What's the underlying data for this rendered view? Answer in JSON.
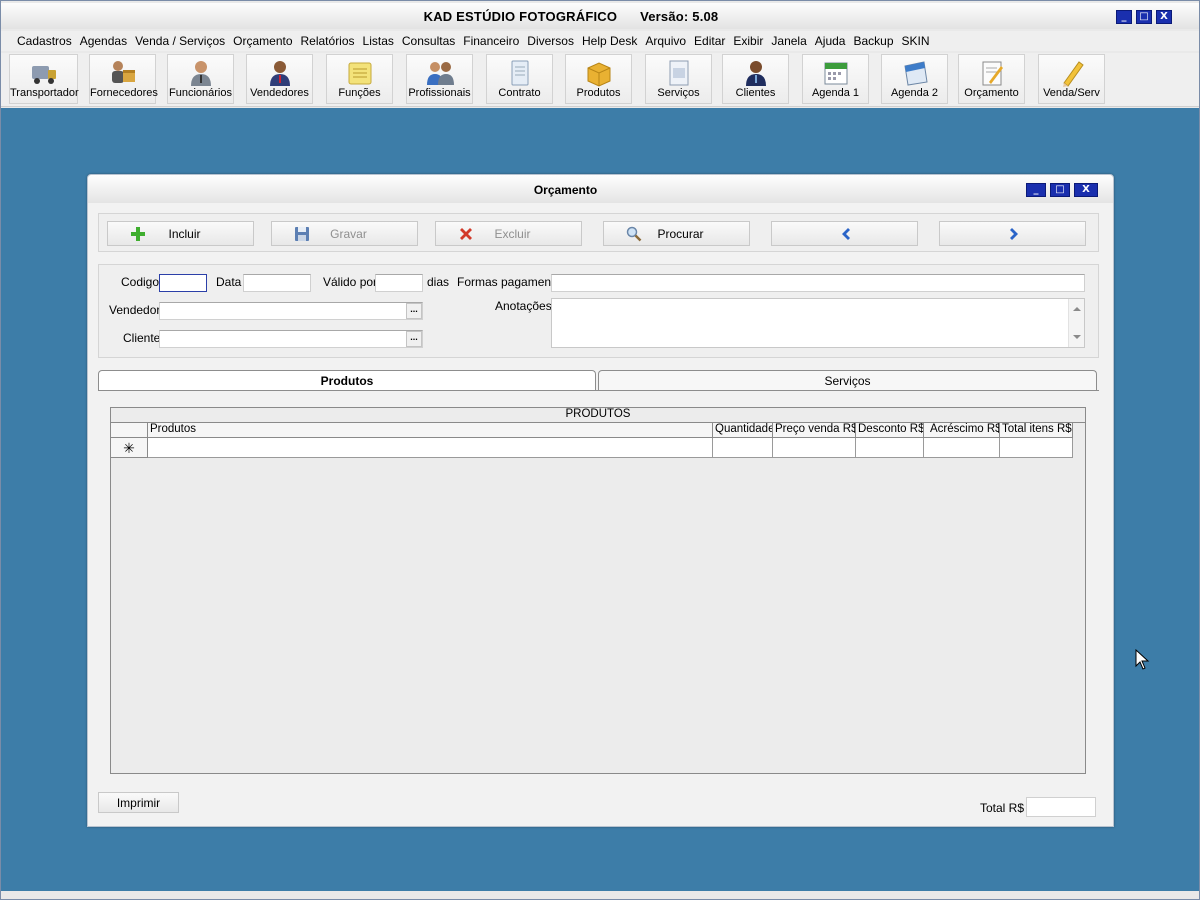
{
  "app": {
    "title": "KAD ESTÚDIO FOTOGRÁFICO",
    "version_label": "Versão: 5.08",
    "window_controls": [
      "_",
      "□",
      "X"
    ]
  },
  "menu": [
    "Cadastros",
    "Agendas",
    "Venda / Serviços",
    "Orçamento",
    "Relatórios",
    "Listas",
    "Consultas",
    "Financeiro",
    "Diversos",
    "Help Desk",
    "Arquivo",
    "Editar",
    "Exibir",
    "Janela",
    "Ajuda",
    "Backup",
    "SKIN"
  ],
  "toolbar": [
    {
      "label": "Transportador",
      "icon": "truck-icon"
    },
    {
      "label": "Fornecedores",
      "icon": "suppliers-icon"
    },
    {
      "label": "Funcionários",
      "icon": "employee-icon"
    },
    {
      "label": "Vendedores",
      "icon": "salesperson-icon"
    },
    {
      "label": "Funções",
      "icon": "notepad-icon"
    },
    {
      "label": "Profissionais",
      "icon": "professionals-icon"
    },
    {
      "label": "Contrato",
      "icon": "contract-icon"
    },
    {
      "label": "Produtos",
      "icon": "box-icon"
    },
    {
      "label": "Serviços",
      "icon": "services-doc-icon"
    },
    {
      "label": "Clientes",
      "icon": "client-icon"
    },
    {
      "label": "Agenda 1",
      "icon": "calendar-icon"
    },
    {
      "label": "Agenda 2",
      "icon": "calendar-2-icon"
    },
    {
      "label": "Orçamento",
      "icon": "quote-icon"
    },
    {
      "label": "Venda/Serv",
      "icon": "pencil-icon"
    }
  ],
  "dialog": {
    "title": "Orçamento",
    "actions": {
      "incluir": "Incluir",
      "gravar": "Gravar",
      "excluir": "Excluir",
      "procurar": "Procurar"
    },
    "form": {
      "codigo_label": "Codigo",
      "data_label": "Data",
      "valido_label": "Válido por",
      "dias_label": "dias",
      "formas_label": "Formas pagamento",
      "vendedor_label": "Vendedor",
      "anotacoes_label": "Anotações",
      "cliente_label": "Cliente",
      "lookup_label": "..."
    },
    "tabs": {
      "produtos": "Produtos",
      "servicos": "Serviços"
    },
    "grid": {
      "caption": "PRODUTOS",
      "columns": [
        "Produtos",
        "Quantidade",
        "Preço venda R$",
        "Desconto R$",
        "Acréscimo R$",
        "Total itens R$"
      ],
      "new_row_marker": "✳"
    },
    "imprimir": "Imprimir",
    "total_label": "Total R$",
    "total_value": ""
  },
  "colors": {
    "workspace": "#3d7da8",
    "window_button": "#1a2fae"
  }
}
